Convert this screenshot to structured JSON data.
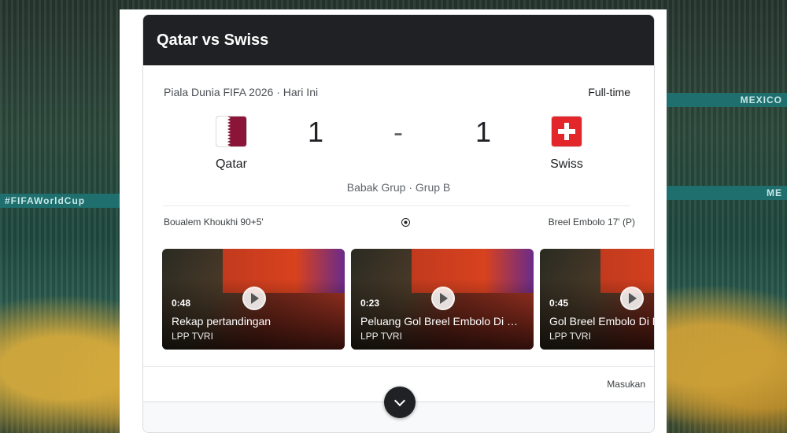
{
  "header": {
    "title": "Qatar vs Swiss"
  },
  "background": {
    "banner_left": "#FIFAWorldCup",
    "banner_right": "MEXICO",
    "banner_right2": "ME"
  },
  "match": {
    "competition": "Piala Dunia FIFA 2026 · Hari Ini",
    "status": "Full-time",
    "home": {
      "name": "Qatar",
      "score": "1",
      "flag_icon": "qatar-flag-icon",
      "color": "#8a1538"
    },
    "away": {
      "name": "Swiss",
      "score": "1",
      "flag_icon": "switzerland-flag-icon",
      "color": "#e3262a"
    },
    "separator": "-",
    "stage": "Babak Grup · Grup B",
    "home_scorer": "Boualem Khoukhi 90+5'",
    "away_scorer": "Breel Embolo 17' (P)"
  },
  "videos": [
    {
      "duration": "0:48",
      "title": "Rekap pertandingan",
      "source": "LPP TVRI"
    },
    {
      "duration": "0:23",
      "title": "Peluang Gol Breel Embolo Di …",
      "source": "LPP TVRI"
    },
    {
      "duration": "0:45",
      "title": "Gol Breel Embolo Di M",
      "source": "LPP TVRI"
    }
  ],
  "footer": {
    "feedback_label": "Masukan"
  }
}
